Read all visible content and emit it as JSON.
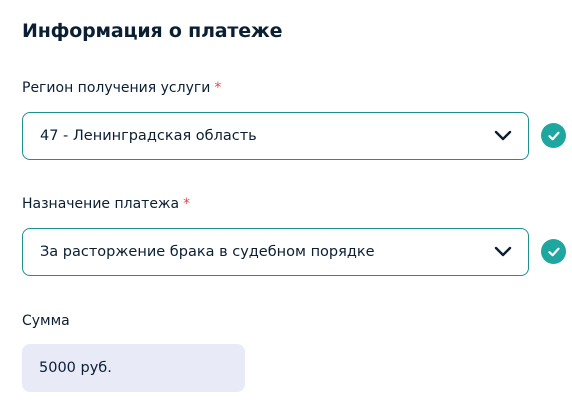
{
  "section": {
    "title": "Информация о платеже"
  },
  "region": {
    "label": "Регион получения услуги",
    "required_mark": "*",
    "value": "47 - Ленинградская область",
    "validated_icon": "check-circle-icon",
    "dropdown_icon": "chevron-down-icon"
  },
  "purpose": {
    "label": "Назначение платежа",
    "required_mark": "*",
    "value": "За расторжение брака в судебном порядке",
    "validated_icon": "check-circle-icon",
    "dropdown_icon": "chevron-down-icon"
  },
  "amount": {
    "label": "Сумма",
    "value": "5000 руб."
  },
  "colors": {
    "accent": "#1ea7a0",
    "border": "#1e8f8a",
    "required": "#e5484d",
    "readonly_bg": "#e8eaf7",
    "text": "#0b1f33"
  }
}
